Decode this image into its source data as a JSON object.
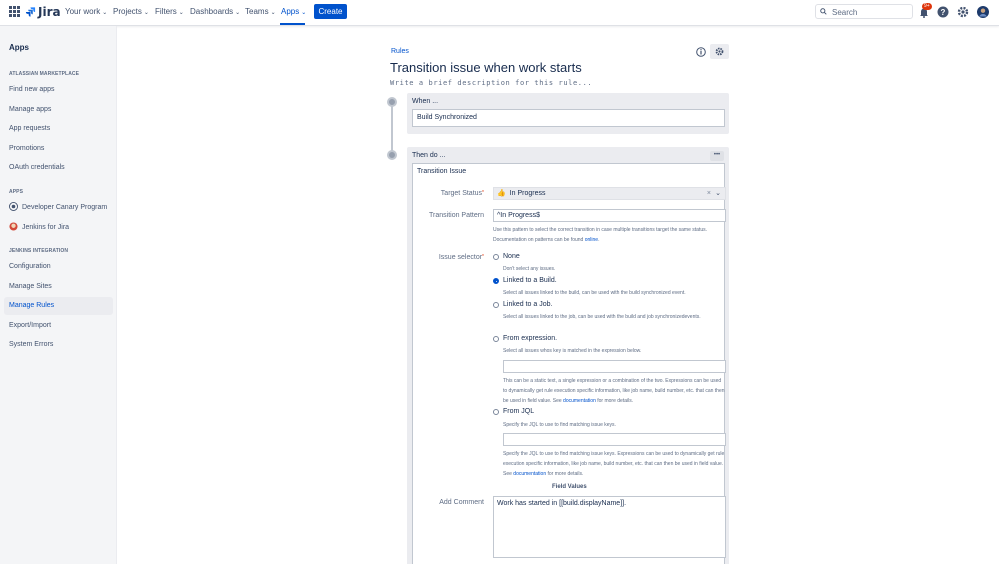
{
  "nav": {
    "logo": "Jira",
    "items": [
      {
        "label": "Your work"
      },
      {
        "label": "Projects"
      },
      {
        "label": "Filters"
      },
      {
        "label": "Dashboards"
      },
      {
        "label": "Teams"
      },
      {
        "label": "Apps"
      }
    ],
    "create": "Create",
    "search_placeholder": "Search",
    "notif_badge": "9+"
  },
  "sidebar": {
    "title": "Apps",
    "sections": [
      {
        "title": "ATLASSIAN MARKETPLACE",
        "items": [
          "Find new apps",
          "Manage apps",
          "App requests",
          "Promotions",
          "OAuth credentials"
        ]
      },
      {
        "title": "APPS",
        "items": [
          "Developer Canary Program",
          "Jenkins for Jira"
        ]
      },
      {
        "title": "JENKINS INTEGRATION",
        "items": [
          "Configuration",
          "Manage Sites",
          "Manage Rules",
          "Export/Import",
          "System Errors"
        ]
      }
    ],
    "active": "Manage Rules"
  },
  "page": {
    "breadcrumb": "Rules",
    "title": "Transition issue when work starts",
    "description_placeholder": "Write a brief description for this rule..."
  },
  "when": {
    "label": "When ...",
    "trigger": "Build Synchronized"
  },
  "then": {
    "label": "Then do ...",
    "more": "•••",
    "action_title": "Transition Issue",
    "target_status_label": "Target Status",
    "target_status_value": "In Progress",
    "pattern_label": "Transition Pattern",
    "pattern_value": "^In Progress$",
    "pattern_help": "Use this pattern to select the correct transition in case multiple transitions target the same status. Documentation on patterns can be found",
    "pattern_help_link": "online",
    "issue_selector_label": "Issue selector",
    "options": [
      {
        "label": "None",
        "help": "Don't select any issues.",
        "selected": false
      },
      {
        "label": "Linked to a Build.",
        "help": "Select all issues linked to the build, can be used with the build synchronized event.",
        "selected": true
      },
      {
        "label": "Linked to a Job.",
        "help": "Select all issues linked to the job, can be used with the build and job synchronizedevents.",
        "selected": false
      },
      {
        "label": "From expression.",
        "help": "Select all issues whos key is matched in the expression below.",
        "selected": false
      },
      {
        "label": "From JQL",
        "help": "Specify the JQL to use to find matching issue keys.",
        "selected": false
      }
    ],
    "expr_help": "This can be a static text, a single expression or a combination of the two. Expressions can be used to dynamically get rule execution specific information, like job name, build number, etc. that can then be used in field value. See",
    "jql_help": "Specify the JQL to use to find matching issue keys. Expressions can be used to dynamically get rule execution specific information, like job name, build number, etc. that can then be used in field value. See",
    "doc_link": "documentation",
    "more_details": "for more details.",
    "field_values": "Field Values",
    "comment_label": "Add Comment",
    "comment_value": "Work has started in [[build.displayName]]."
  }
}
